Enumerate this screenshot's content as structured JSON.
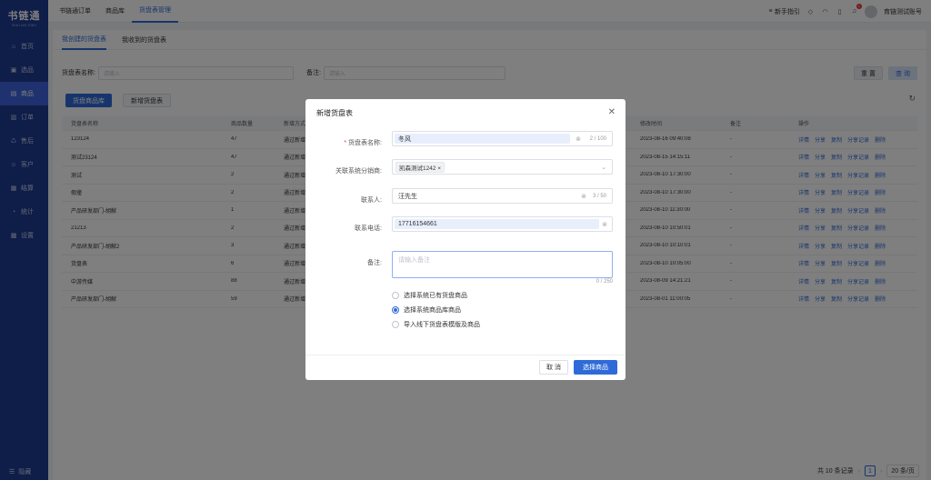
{
  "app": {
    "logo": "书链通",
    "logo_sub": "SHU LIAN TONG"
  },
  "sidebar": {
    "items": [
      {
        "label": "首页",
        "icon": "home-icon",
        "glyph": "⌂"
      },
      {
        "label": "选品",
        "icon": "select-icon",
        "glyph": "▣"
      },
      {
        "label": "商品",
        "icon": "product-icon",
        "glyph": "▤"
      },
      {
        "label": "订单",
        "icon": "order-icon",
        "glyph": "▥"
      },
      {
        "label": "售后",
        "icon": "aftersale-icon",
        "glyph": "♺"
      },
      {
        "label": "客户",
        "icon": "customer-icon",
        "glyph": "☺"
      },
      {
        "label": "结算",
        "icon": "settle-icon",
        "glyph": "▦"
      },
      {
        "label": "统计",
        "icon": "stats-icon",
        "glyph": "◔"
      },
      {
        "label": "设置",
        "icon": "settings-icon",
        "glyph": "▩"
      }
    ],
    "active_index": 2,
    "collapse": "隐藏"
  },
  "topnav": {
    "tabs": [
      "书链通订单",
      "商品库",
      "货盘表管理"
    ],
    "active_index": 2,
    "guide": "新手指引",
    "notify_count": "1",
    "account": "育链测试账号"
  },
  "subtabs": [
    "我创建的货盘表",
    "我收到的货盘表"
  ],
  "filter": {
    "name_label": "货盘表名称:",
    "name_placeholder": "请输入",
    "note_label": "备注:",
    "note_placeholder": "请输入",
    "reset": "重 置",
    "search": "查 询"
  },
  "actions": {
    "lib": "货盘商品库",
    "new": "新增货盘表"
  },
  "table": {
    "headers": [
      "货盘表名称",
      "商品数量",
      "新增方式",
      "修改时间",
      "备注",
      "操作"
    ],
    "rows": [
      {
        "name": "123124",
        "count": "47",
        "mode": "通过新增",
        "time": "2023-08-16 09:40:08",
        "note": "-"
      },
      {
        "name": "测试23124",
        "count": "47",
        "mode": "通过新增",
        "time": "2023-08-15 14:15:11",
        "note": "-"
      },
      {
        "name": "测试",
        "count": "2",
        "mode": "通过新增",
        "time": "2023-08-10 17:30:00",
        "note": "-"
      },
      {
        "name": "假撞",
        "count": "2",
        "mode": "通过新增",
        "time": "2023-08-10 17:30:00",
        "note": "-"
      },
      {
        "name": "产品研发部门-胡献",
        "count": "1",
        "mode": "通过新增",
        "time": "2023-08-10 11:30:00",
        "note": "-"
      },
      {
        "name": "21213",
        "count": "2",
        "mode": "通过新增",
        "time": "2023-08-10 10:50:01",
        "note": "-"
      },
      {
        "name": "产品研发部门-胡献2",
        "count": "3",
        "mode": "通过新增",
        "time": "2023-08-10 10:10:01",
        "note": "-"
      },
      {
        "name": "货盘表",
        "count": "6",
        "mode": "通过新增",
        "time": "2023-08-10 10:05:00",
        "note": "-"
      },
      {
        "name": "中游传媒",
        "count": "88",
        "mode": "通过新增",
        "time": "2023-08-09 14:21:21",
        "note": "-"
      },
      {
        "name": "产品研发部门-胡献",
        "count": "59",
        "mode": "通过新增",
        "time": "2023-08-01 11:00:05",
        "note": "-"
      }
    ],
    "ops": [
      "详情",
      "分享",
      "复制",
      "分享记录",
      "删除"
    ]
  },
  "pager": {
    "total": "共 10 条记录",
    "page": "1",
    "size": "20 条/页"
  },
  "modal": {
    "title": "新增货盘表",
    "name_label": "货盘表名称:",
    "name_value": "冬风",
    "name_count": "2 / 100",
    "dist_label": "关联系统分销商:",
    "dist_tag": "凯森测试1242",
    "contact_label": "联系人:",
    "contact_value": "汪先生",
    "contact_count": "3 / 50",
    "phone_label": "联系电话:",
    "phone_value": "17716154661",
    "note_label": "备注:",
    "note_placeholder": "请输入备注",
    "note_count": "0 / 250",
    "options": [
      "选择系统已有货盘商品",
      "选择系统商品库商品",
      "导入线下货盘表模版及商品"
    ],
    "selected_option": 1,
    "cancel": "取 消",
    "confirm": "选择商品"
  },
  "colors": {
    "primary": "#2f6bd8",
    "sidebar": "#1f3a93",
    "sidebar_active": "#3e63dd"
  }
}
